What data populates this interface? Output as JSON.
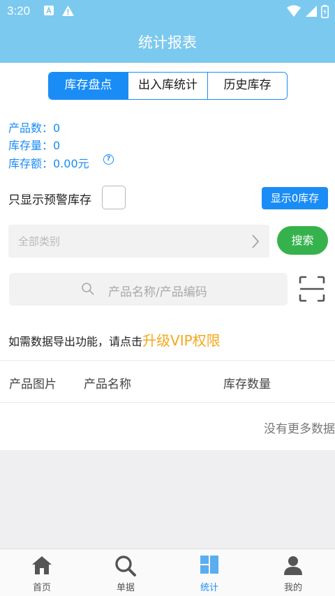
{
  "status_bar": {
    "time": "3:20"
  },
  "header": {
    "title": "统计报表"
  },
  "tabs": [
    {
      "label": "库存盘点",
      "active": true
    },
    {
      "label": "出入库统计",
      "active": false
    },
    {
      "label": "历史库存",
      "active": false
    }
  ],
  "stats": {
    "product_count": "产品数：0",
    "stock_qty": "库存量：0",
    "stock_amount": "库存额：0.00元"
  },
  "filters": {
    "warn_only_label": "只显示预警库存",
    "warn_only_checked": false,
    "show_zero_button": "显示0库存",
    "category_placeholder": "全部类别",
    "search_button": "搜索",
    "search_placeholder": "产品名称/产品编码"
  },
  "vip_notice": {
    "text": "如需数据导出功能，请点击",
    "link": "升级VIP权限"
  },
  "table": {
    "columns": [
      "产品图片",
      "产品名称",
      "库存数量"
    ],
    "empty_message": "没有更多数据"
  },
  "bottom_nav": [
    {
      "label": "首页",
      "icon": "home-icon",
      "active": false
    },
    {
      "label": "单据",
      "icon": "search-icon",
      "active": false
    },
    {
      "label": "统计",
      "icon": "stats-icon",
      "active": true
    },
    {
      "label": "我的",
      "icon": "person-icon",
      "active": false
    }
  ],
  "colors": {
    "header": "#7cc9ef",
    "accent": "#1a8cf5",
    "search_button": "#35b24c",
    "vip": "#f3a81c"
  }
}
